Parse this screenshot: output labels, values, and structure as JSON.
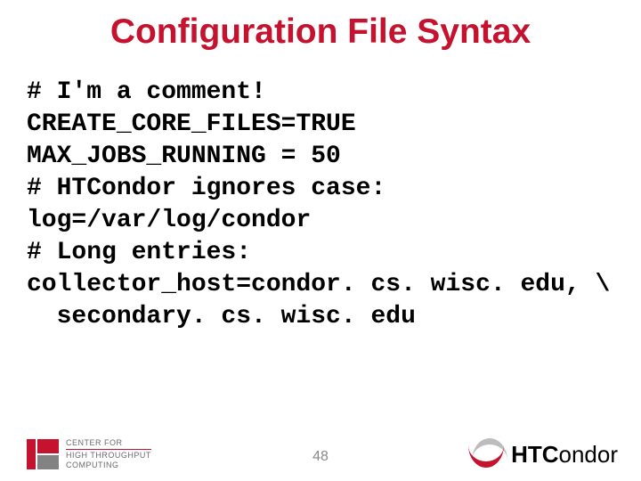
{
  "title": "Configuration File Syntax",
  "code": [
    "# I'm a comment!",
    "CREATE_CORE_FILES=TRUE",
    "MAX_JOBS_RUNNING = 50",
    "# HTCondor ignores case:",
    "log=/var/log/condor",
    "# Long entries:",
    "collector_host=condor. cs. wisc. edu, \\",
    "  secondary. cs. wisc. edu"
  ],
  "page": "48",
  "logos": {
    "left": {
      "line1": "CENTER FOR",
      "line2": "HIGH THROUGHPUT",
      "line3": "COMPUTING"
    },
    "right": {
      "bold": "HTC",
      "light": "ondor"
    }
  }
}
